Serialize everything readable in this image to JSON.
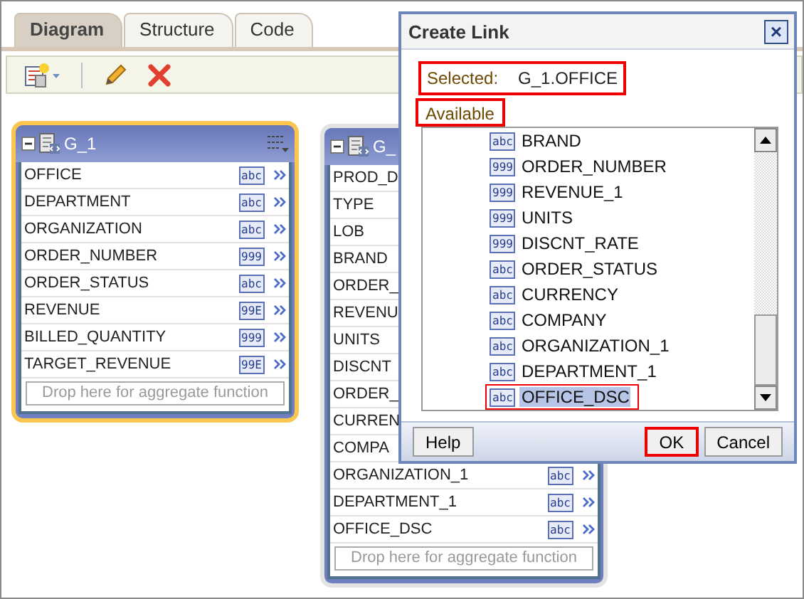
{
  "tabs": [
    {
      "label": "Diagram",
      "selected": true
    },
    {
      "label": "Structure",
      "selected": false
    },
    {
      "label": "Code",
      "selected": false
    }
  ],
  "groups": [
    {
      "title": "G_1",
      "selected": true,
      "menu": true,
      "rows": [
        {
          "name": "OFFICE",
          "type": "abc"
        },
        {
          "name": "DEPARTMENT",
          "type": "abc"
        },
        {
          "name": "ORGANIZATION",
          "type": "abc"
        },
        {
          "name": "ORDER_NUMBER",
          "type": "999"
        },
        {
          "name": "ORDER_STATUS",
          "type": "abc"
        },
        {
          "name": "REVENUE",
          "type": "99E"
        },
        {
          "name": "BILLED_QUANTITY",
          "type": "999"
        },
        {
          "name": "TARGET_REVENUE",
          "type": "99E"
        }
      ],
      "drop_hint": "Drop here for aggregate function"
    },
    {
      "title": "G_",
      "selected": false,
      "rows": [
        {
          "name": "PROD_D"
        },
        {
          "name": "TYPE"
        },
        {
          "name": "LOB"
        },
        {
          "name": "BRAND"
        },
        {
          "name": "ORDER_"
        },
        {
          "name": "REVENU"
        },
        {
          "name": "UNITS"
        },
        {
          "name": "DISCNT"
        },
        {
          "name": "ORDER_"
        },
        {
          "name": "CURREN"
        },
        {
          "name": "COMPA"
        },
        {
          "name": "ORGANIZATION_1",
          "type": "abc"
        },
        {
          "name": "DEPARTMENT_1",
          "type": "abc"
        },
        {
          "name": "OFFICE_DSC",
          "type": "abc"
        }
      ],
      "drop_hint": "Drop here for aggregate function"
    }
  ],
  "dialog": {
    "title": "Create Link",
    "close": "×",
    "selected_label": "Selected:",
    "selected_value": "G_1.OFFICE",
    "available_label": "Available",
    "items": [
      {
        "name": "BRAND",
        "type": "abc",
        "selected": false,
        "annotated": false
      },
      {
        "name": "ORDER_NUMBER",
        "type": "999",
        "selected": false,
        "annotated": false
      },
      {
        "name": "REVENUE_1",
        "type": "999",
        "selected": false,
        "annotated": false
      },
      {
        "name": "UNITS",
        "type": "999",
        "selected": false,
        "annotated": false
      },
      {
        "name": "DISCNT_RATE",
        "type": "999",
        "selected": false,
        "annotated": false
      },
      {
        "name": "ORDER_STATUS",
        "type": "abc",
        "selected": false,
        "annotated": false
      },
      {
        "name": "CURRENCY",
        "type": "abc",
        "selected": false,
        "annotated": false
      },
      {
        "name": "COMPANY",
        "type": "abc",
        "selected": false,
        "annotated": false
      },
      {
        "name": "ORGANIZATION_1",
        "type": "abc",
        "selected": false,
        "annotated": false
      },
      {
        "name": "DEPARTMENT_1",
        "type": "abc",
        "selected": false,
        "annotated": false
      },
      {
        "name": "OFFICE_DSC",
        "type": "abc",
        "selected": true,
        "annotated": true
      }
    ],
    "buttons": [
      {
        "label": "Help",
        "annotated": false
      },
      {
        "label": "OK",
        "annotated": true
      },
      {
        "label": "Cancel",
        "annotated": false
      }
    ]
  }
}
